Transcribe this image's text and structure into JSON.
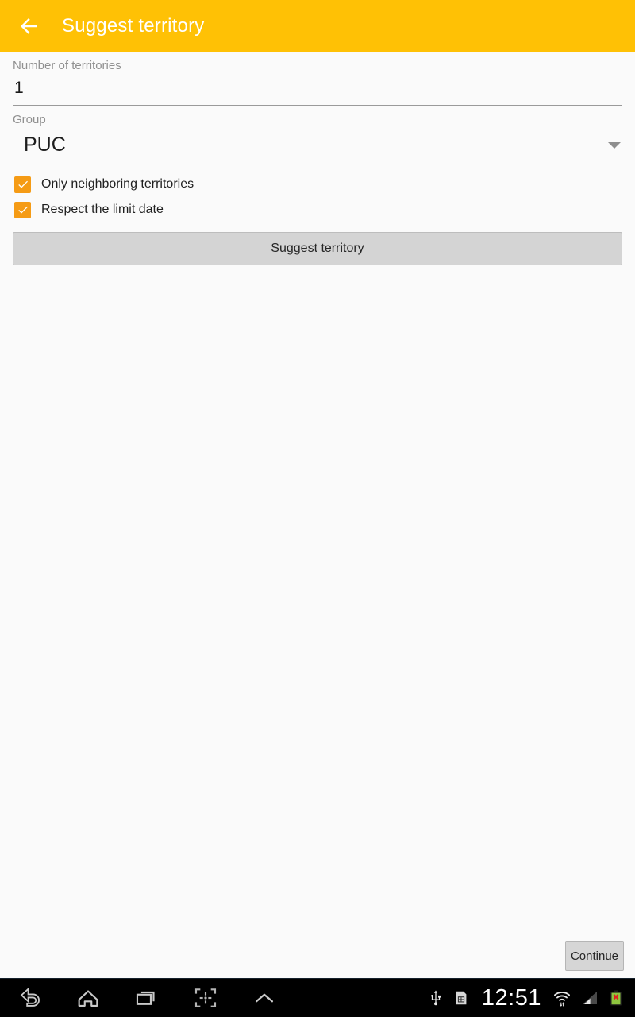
{
  "appbar": {
    "back_icon": "back-arrow-icon",
    "title": "Suggest territory",
    "background": "#FFC105",
    "title_color": "#FFFFFF"
  },
  "form": {
    "number_field": {
      "label": "Number of territories",
      "value": "1",
      "placeholder": ""
    },
    "group_field": {
      "label": "Group",
      "value": "PUC",
      "dropdown_icon": "chevron-down-icon",
      "options": [
        "PUC"
      ]
    },
    "checkboxes": [
      {
        "label": "Only neighboring territories",
        "checked": true,
        "color": "#F59B15"
      },
      {
        "label": "Respect the limit date",
        "checked": true,
        "color": "#F59B15"
      }
    ],
    "submit_button": {
      "label": "Suggest territory"
    }
  },
  "continue_button": {
    "label": "Continue"
  },
  "navbar": {
    "buttons": [
      {
        "name": "back-nav-icon"
      },
      {
        "name": "home-nav-icon"
      },
      {
        "name": "recents-nav-icon"
      },
      {
        "name": "screenshot-nav-icon"
      },
      {
        "name": "chevron-up-nav-icon"
      }
    ],
    "status": {
      "usb_icon": "usb-icon",
      "sim_icon": "sim-card-icon",
      "time": "12:51",
      "wifi_icon": "wifi-icon",
      "signal_icon": "cell-signal-icon",
      "battery_icon": "battery-error-icon"
    }
  }
}
